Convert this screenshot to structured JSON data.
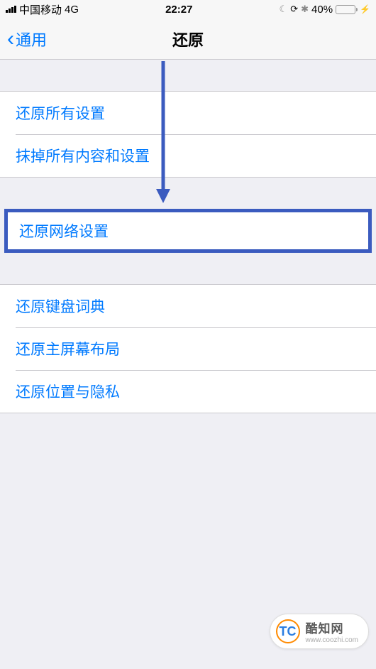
{
  "status": {
    "carrier": "中国移动",
    "network": "4G",
    "time": "22:27",
    "battery_pct": "40%"
  },
  "nav": {
    "back_label": "通用",
    "title": "还原"
  },
  "groups": {
    "g1": {
      "reset_all": "还原所有设置",
      "erase_all": "抹掉所有内容和设置"
    },
    "g2": {
      "reset_network": "还原网络设置"
    },
    "g3": {
      "reset_keyboard": "还原键盘词典",
      "reset_home": "还原主屏幕布局",
      "reset_location": "还原位置与隐私"
    }
  },
  "watermark": {
    "logo_text": "TC",
    "name": "酷知网",
    "url": "www.coozhi.com"
  }
}
